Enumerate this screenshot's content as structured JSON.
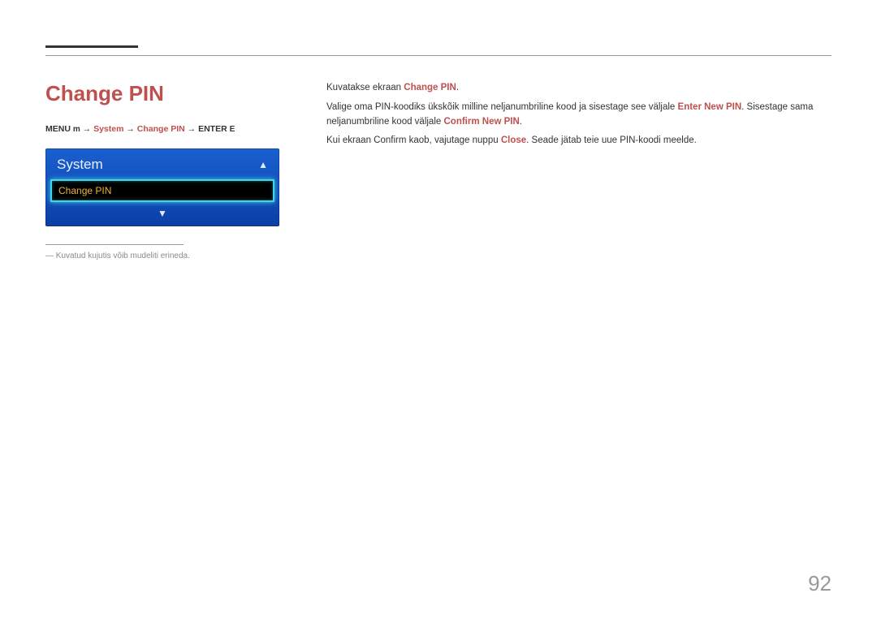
{
  "title": "Change PIN",
  "breadcrumb": {
    "menu": "MENU",
    "menu_icon": "m",
    "arrow": " → ",
    "system": "System",
    "change_pin": "Change PIN",
    "enter": "ENTER",
    "enter_icon": "E"
  },
  "menu_mock": {
    "header": "System",
    "selected": "Change PIN"
  },
  "footnote_marker": "―",
  "footnote": "Kuvatud kujutis võib mudeliti erineda.",
  "body": {
    "p1_a": "Kuvatakse ekraan ",
    "p1_b": "Change PIN",
    "p1_c": ".",
    "p2_a": "Valige oma PIN-koodiks ükskõik milline neljanumbriline kood ja sisestage see väljale ",
    "p2_b": "Enter New PIN",
    "p2_c": ". Sisestage sama neljanumbriline kood väljale ",
    "p2_d": "Confirm New PIN",
    "p2_e": ".",
    "p3_a": "Kui ekraan Confirm kaob, vajutage nuppu ",
    "p3_b": "Close",
    "p3_c": ". Seade jätab teie uue PIN-koodi meelde."
  },
  "page_number": "92"
}
